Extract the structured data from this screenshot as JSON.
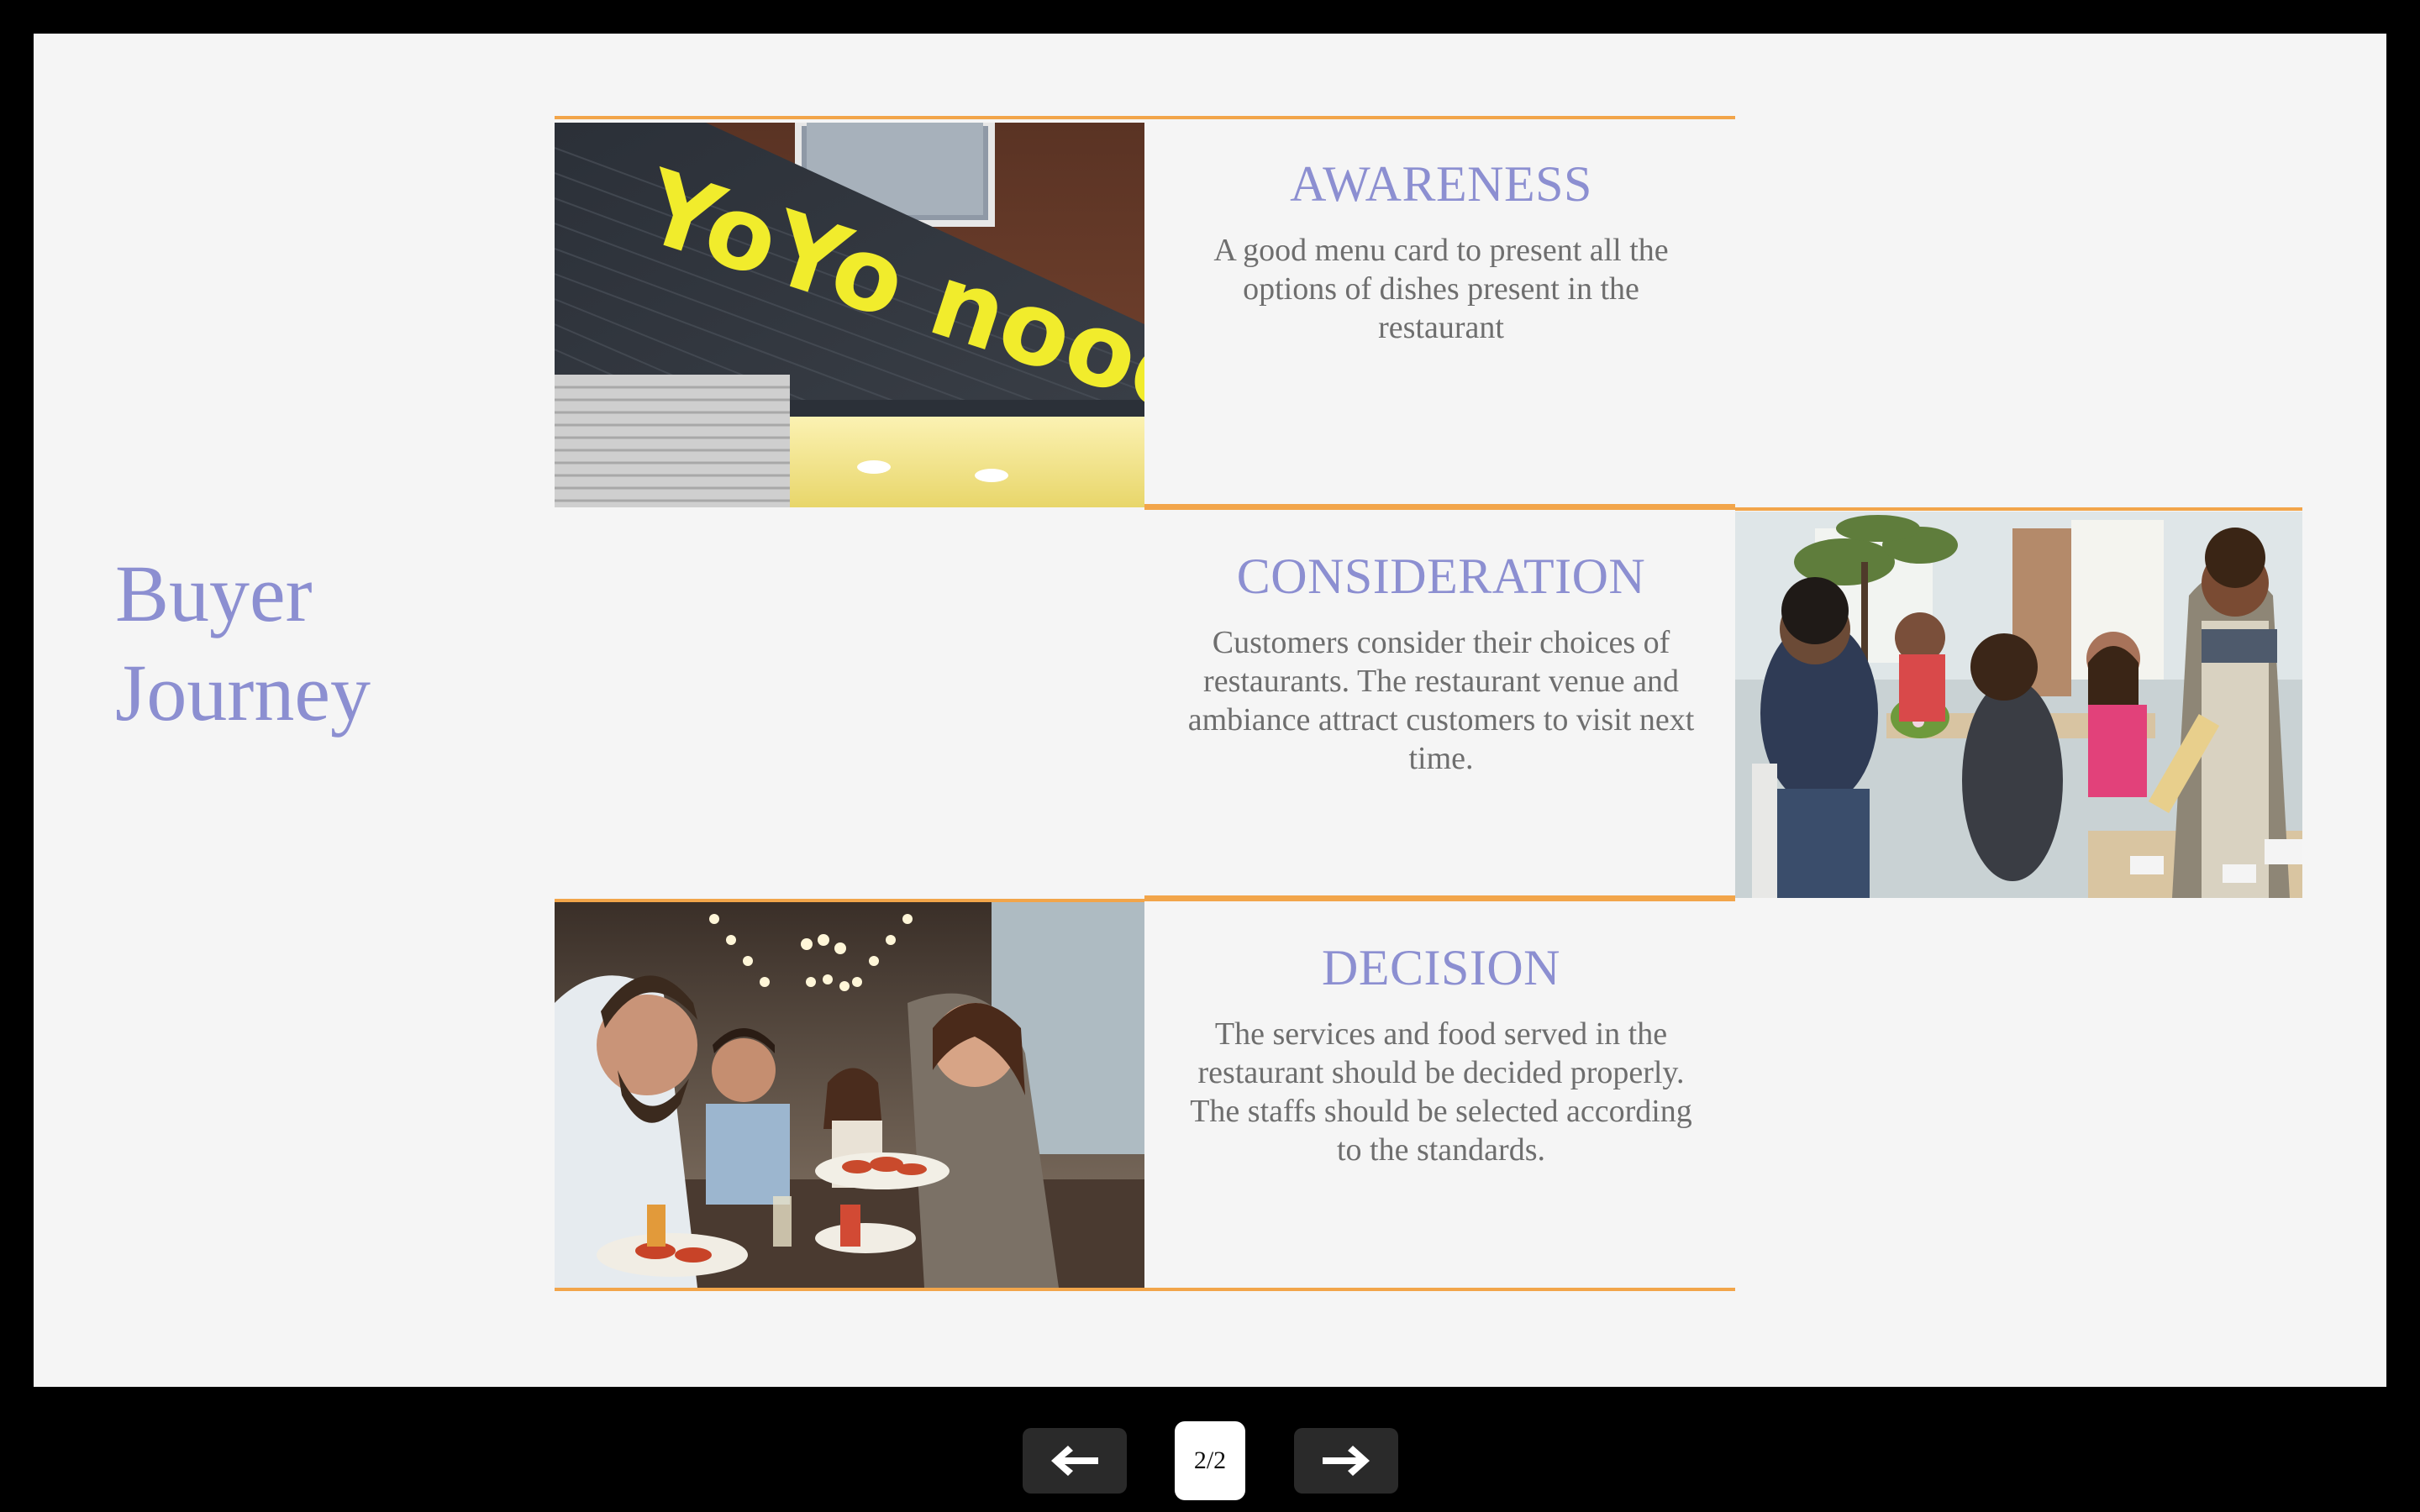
{
  "slide": {
    "title_line1": "Buyer",
    "title_line2": "Journey",
    "accent_color": "#f2a54a",
    "heading_color": "#8c8fd1",
    "background": "#f5f5f5"
  },
  "stages": [
    {
      "heading": "AWARENESS",
      "body": "A good menu card to present all the options of dishes present in the restaurant",
      "image": "yoyo-noodle-storefront-photo",
      "sign_text": "YoYo noodle"
    },
    {
      "heading": "CONSIDERATION",
      "body": "Customers consider their choices of restaurants. The restaurant venue and ambiance attract customers to visit next time.",
      "image": "restaurant-dining-room-photo"
    },
    {
      "heading": "DECISION",
      "body": "The services and food served in the restaurant should be decided properly. The staffs should be selected according to the standards.",
      "image": "friends-dining-photo"
    }
  ],
  "controls": {
    "prev_icon": "arrow-left-icon",
    "next_icon": "arrow-right-icon",
    "page_indicator": "2/2"
  }
}
